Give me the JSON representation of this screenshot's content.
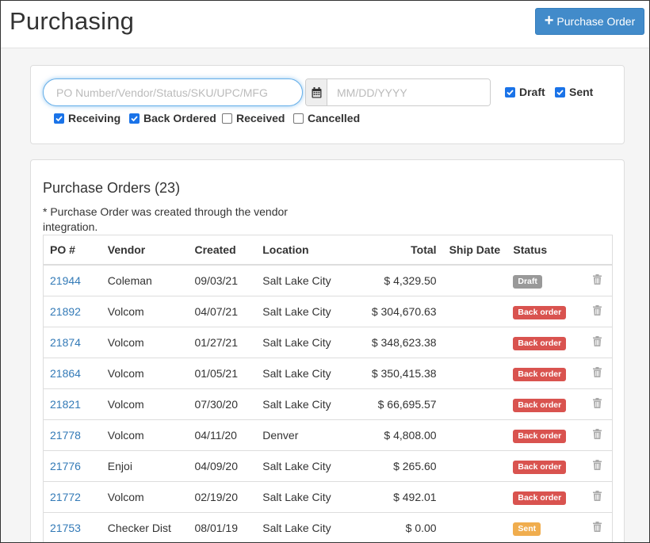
{
  "header": {
    "title": "Purchasing",
    "new_po_label": "Purchase Order"
  },
  "filters": {
    "search_placeholder": "PO Number/Vendor/Status/SKU/UPC/MFG",
    "date_placeholder": "MM/DD/YYYY",
    "checkboxes": [
      {
        "label": "Draft",
        "checked": true
      },
      {
        "label": "Sent",
        "checked": true
      },
      {
        "label": "Receiving",
        "checked": true
      },
      {
        "label": "Back Ordered",
        "checked": true
      },
      {
        "label": "Received",
        "checked": false
      },
      {
        "label": "Cancelled",
        "checked": false
      }
    ]
  },
  "list": {
    "title": "Purchase Orders (23)",
    "note": "* Purchase Order was created through the vendor integration.",
    "columns": {
      "po": "PO #",
      "vendor": "Vendor",
      "created": "Created",
      "location": "Location",
      "total": "Total",
      "ship_date": "Ship Date",
      "status": "Status"
    },
    "rows": [
      {
        "po": "21944",
        "vendor": "Coleman",
        "created": "09/03/21",
        "location": "Salt Lake City",
        "total": "$ 4,329.50",
        "ship_date": "",
        "status": "Draft",
        "status_type": "draft"
      },
      {
        "po": "21892",
        "vendor": "Volcom",
        "created": "04/07/21",
        "location": "Salt Lake City",
        "total": "$ 304,670.63",
        "ship_date": "",
        "status": "Back order",
        "status_type": "backorder"
      },
      {
        "po": "21874",
        "vendor": "Volcom",
        "created": "01/27/21",
        "location": "Salt Lake City",
        "total": "$ 348,623.38",
        "ship_date": "",
        "status": "Back order",
        "status_type": "backorder"
      },
      {
        "po": "21864",
        "vendor": "Volcom",
        "created": "01/05/21",
        "location": "Salt Lake City",
        "total": "$ 350,415.38",
        "ship_date": "",
        "status": "Back order",
        "status_type": "backorder"
      },
      {
        "po": "21821",
        "vendor": "Volcom",
        "created": "07/30/20",
        "location": "Salt Lake City",
        "total": "$ 66,695.57",
        "ship_date": "",
        "status": "Back order",
        "status_type": "backorder"
      },
      {
        "po": "21778",
        "vendor": "Volcom",
        "created": "04/11/20",
        "location": "Denver",
        "total": "$ 4,808.00",
        "ship_date": "",
        "status": "Back order",
        "status_type": "backorder"
      },
      {
        "po": "21776",
        "vendor": "Enjoi",
        "created": "04/09/20",
        "location": "Salt Lake City",
        "total": "$ 265.60",
        "ship_date": "",
        "status": "Back order",
        "status_type": "backorder"
      },
      {
        "po": "21772",
        "vendor": "Volcom",
        "created": "02/19/20",
        "location": "Salt Lake City",
        "total": "$ 492.01",
        "ship_date": "",
        "status": "Back order",
        "status_type": "backorder"
      },
      {
        "po": "21753",
        "vendor": "Checker Dist",
        "created": "08/01/19",
        "location": "Salt Lake City",
        "total": "$ 0.00",
        "ship_date": "",
        "status": "Sent",
        "status_type": "sent"
      }
    ]
  },
  "colors": {
    "primary": "#428bca",
    "link": "#337ab7",
    "draft": "#999999",
    "backorder": "#d9534f",
    "sent": "#f0ad4e",
    "checkbox": "#1a73e8"
  },
  "icons": {
    "add": "plus-icon",
    "calendar": "calendar-icon",
    "delete": "trash-icon"
  }
}
